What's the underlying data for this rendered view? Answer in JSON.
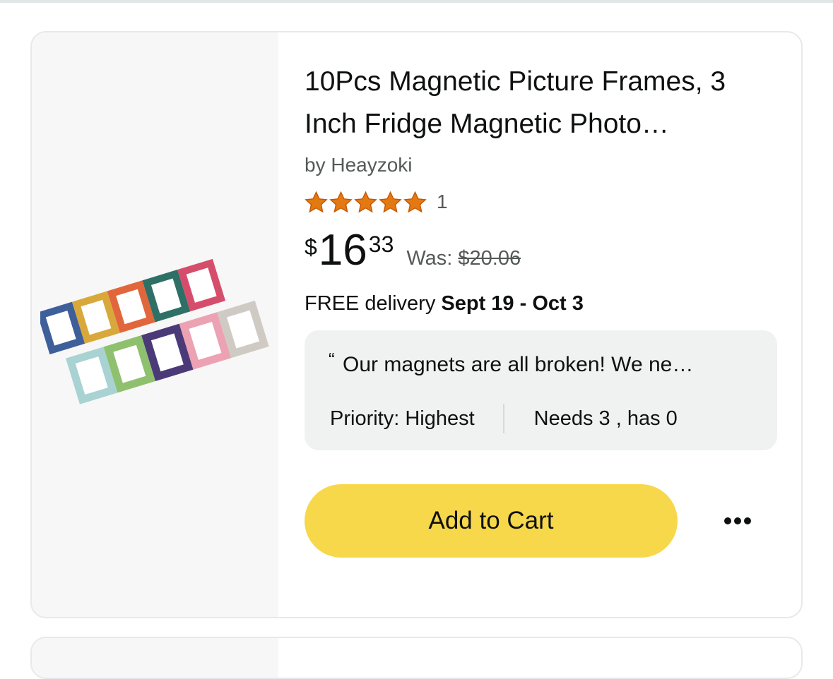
{
  "product": {
    "title": "10Pcs Magnetic Picture Frames, 3 Inch Fridge Magnetic Photo…",
    "brand": "by Heayzoki",
    "rating": {
      "stars": 5,
      "max_stars": 5,
      "count": "1"
    },
    "price": {
      "symbol": "$",
      "whole": "16",
      "fraction": "33"
    },
    "was": {
      "label": "Was:",
      "price": "$20.06"
    },
    "delivery": {
      "prefix": "FREE delivery",
      "dates": "Sept 19 - Oct 3"
    },
    "review": {
      "quote_mark": "“",
      "text": "Our magnets are all broken! We ne…",
      "priority": "Priority: Highest",
      "needs": "Needs 3 , has 0"
    },
    "add_to_cart_label": "Add to Cart",
    "more_icon": "more-options-icon"
  },
  "colors": {
    "star": "#e47911",
    "button": "#f7d84a",
    "review_bg": "#f0f2f2",
    "image_bg": "#f7f7f7"
  }
}
